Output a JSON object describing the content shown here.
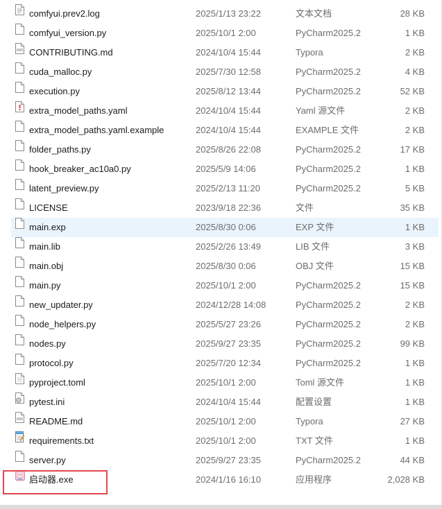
{
  "files": [
    {
      "name": "comfyui.prev2.log",
      "date": "2025/1/13 23:22",
      "type": "文本文档",
      "size": "28 KB",
      "icon": "text-file-icon"
    },
    {
      "name": "comfyui_version.py",
      "date": "2025/10/1 2:00",
      "type": "PyCharm2025.2",
      "size": "1 KB",
      "icon": "python-file-icon"
    },
    {
      "name": "CONTRIBUTING.md",
      "date": "2024/10/4 15:44",
      "type": "Typora",
      "size": "2 KB",
      "icon": "markdown-file-icon"
    },
    {
      "name": "cuda_malloc.py",
      "date": "2025/7/30 12:58",
      "type": "PyCharm2025.2",
      "size": "4 KB",
      "icon": "python-file-icon"
    },
    {
      "name": "execution.py",
      "date": "2025/8/12 13:44",
      "type": "PyCharm2025.2",
      "size": "52 KB",
      "icon": "python-file-icon"
    },
    {
      "name": "extra_model_paths.yaml",
      "date": "2024/10/4 15:44",
      "type": "Yaml 源文件",
      "size": "2 KB",
      "icon": "yaml-file-icon"
    },
    {
      "name": "extra_model_paths.yaml.example",
      "date": "2024/10/4 15:44",
      "type": "EXAMPLE 文件",
      "size": "2 KB",
      "icon": "generic-file-icon"
    },
    {
      "name": "folder_paths.py",
      "date": "2025/8/26 22:08",
      "type": "PyCharm2025.2",
      "size": "17 KB",
      "icon": "python-file-icon"
    },
    {
      "name": "hook_breaker_ac10a0.py",
      "date": "2025/5/9 14:06",
      "type": "PyCharm2025.2",
      "size": "1 KB",
      "icon": "python-file-icon"
    },
    {
      "name": "latent_preview.py",
      "date": "2025/2/13 11:20",
      "type": "PyCharm2025.2",
      "size": "5 KB",
      "icon": "python-file-icon"
    },
    {
      "name": "LICENSE",
      "date": "2023/9/18 22:36",
      "type": "文件",
      "size": "35 KB",
      "icon": "generic-file-icon"
    },
    {
      "name": "main.exp",
      "date": "2025/8/30 0:06",
      "type": "EXP 文件",
      "size": "1 KB",
      "icon": "generic-file-icon",
      "selected": true
    },
    {
      "name": "main.lib",
      "date": "2025/2/26 13:49",
      "type": "LIB 文件",
      "size": "3 KB",
      "icon": "generic-file-icon"
    },
    {
      "name": "main.obj",
      "date": "2025/8/30 0:06",
      "type": "OBJ 文件",
      "size": "15 KB",
      "icon": "generic-file-icon"
    },
    {
      "name": "main.py",
      "date": "2025/10/1 2:00",
      "type": "PyCharm2025.2",
      "size": "15 KB",
      "icon": "python-file-icon"
    },
    {
      "name": "new_updater.py",
      "date": "2024/12/28 14:08",
      "type": "PyCharm2025.2",
      "size": "2 KB",
      "icon": "python-file-icon"
    },
    {
      "name": "node_helpers.py",
      "date": "2025/5/27 23:26",
      "type": "PyCharm2025.2",
      "size": "2 KB",
      "icon": "python-file-icon"
    },
    {
      "name": "nodes.py",
      "date": "2025/9/27 23:35",
      "type": "PyCharm2025.2",
      "size": "99 KB",
      "icon": "python-file-icon"
    },
    {
      "name": "protocol.py",
      "date": "2025/7/20 12:34",
      "type": "PyCharm2025.2",
      "size": "1 KB",
      "icon": "python-file-icon"
    },
    {
      "name": "pyproject.toml",
      "date": "2025/10/1 2:00",
      "type": "Toml 源文件",
      "size": "1 KB",
      "icon": "toml-file-icon"
    },
    {
      "name": "pytest.ini",
      "date": "2024/10/4 15:44",
      "type": "配置设置",
      "size": "1 KB",
      "icon": "settings-file-icon"
    },
    {
      "name": "README.md",
      "date": "2025/10/1 2:00",
      "type": "Typora",
      "size": "27 KB",
      "icon": "markdown-file-icon"
    },
    {
      "name": "requirements.txt",
      "date": "2025/10/1 2:00",
      "type": "TXT 文件",
      "size": "1 KB",
      "icon": "notepad-file-icon"
    },
    {
      "name": "server.py",
      "date": "2025/9/27 23:35",
      "type": "PyCharm2025.2",
      "size": "44 KB",
      "icon": "python-file-icon"
    },
    {
      "name": "启动器.exe",
      "date": "2024/1/16 16:10",
      "type": "应用程序",
      "size": "2,028 KB",
      "icon": "app-exe-icon"
    }
  ],
  "colors": {
    "selection": "#eaf4fd",
    "highlight_border": "#e0474c",
    "secondary_text": "#6d6d6d"
  }
}
